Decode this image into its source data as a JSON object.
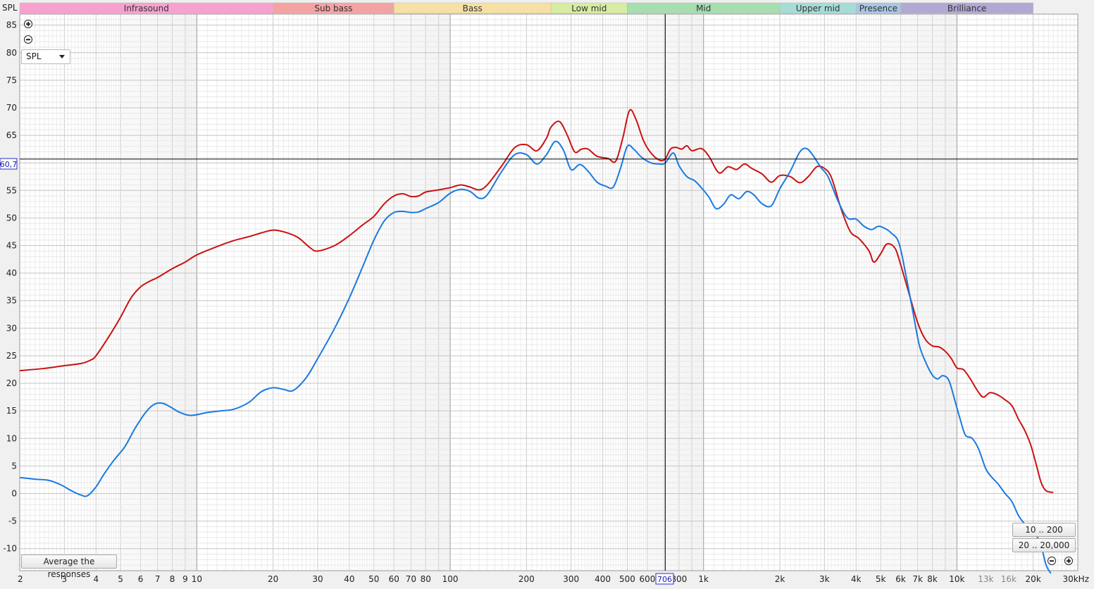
{
  "y_axis_title": "SPL",
  "spl_select": {
    "value": "SPL",
    "icon": "caret-down-icon"
  },
  "cursor": {
    "y_label": "60,7",
    "x_label": "706",
    "x_value": 706,
    "y_value": 60.7
  },
  "buttons": {
    "average": "Average the responses",
    "range_10_200": "10 .. 200",
    "range_20_20000": "20 .. 20,000"
  },
  "icons": {
    "zoom_in": "zoom-in-icon",
    "zoom_out": "zoom-out-icon"
  },
  "colors": {
    "red_trace": "#cc1111",
    "blue_trace": "#1a7ae0",
    "plot_bg": "#ffffff",
    "grid_major": "#9a9a9a",
    "grid_minor": "#dddddd",
    "cursor": "#000000"
  },
  "bands": [
    {
      "label": "Infrasound",
      "from": 2,
      "to": 20,
      "color": "#f7a1cf"
    },
    {
      "label": "Sub bass",
      "from": 20,
      "to": 60,
      "color": "#f4a3a3"
    },
    {
      "label": "Bass",
      "from": 60,
      "to": 250,
      "color": "#f6e0a3"
    },
    {
      "label": "Low mid",
      "from": 250,
      "to": 500,
      "color": "#d8eca2"
    },
    {
      "label": "Mid",
      "from": 500,
      "to": 2000,
      "color": "#a6deb0"
    },
    {
      "label": "Upper mid",
      "from": 2000,
      "to": 4000,
      "color": "#a5dcd6"
    },
    {
      "label": "Presence",
      "from": 4000,
      "to": 6000,
      "color": "#a9c5e5"
    },
    {
      "label": "Brilliance",
      "from": 6000,
      "to": 20000,
      "color": "#b3a7d3"
    }
  ],
  "chart_data": {
    "type": "line",
    "xscale": "log",
    "xlim": [
      2,
      30000
    ],
    "ylim": [
      -14,
      87
    ],
    "xlabel": "",
    "ylabel": "SPL",
    "grid": true,
    "x_tick_labels": [
      {
        "v": 2,
        "t": "2"
      },
      {
        "v": 3,
        "t": "3"
      },
      {
        "v": 4,
        "t": "4"
      },
      {
        "v": 5,
        "t": "5"
      },
      {
        "v": 6,
        "t": "6"
      },
      {
        "v": 7,
        "t": "7"
      },
      {
        "v": 8,
        "t": "8"
      },
      {
        "v": 9,
        "t": "9"
      },
      {
        "v": 10,
        "t": "10"
      },
      {
        "v": 20,
        "t": "20"
      },
      {
        "v": 30,
        "t": "30"
      },
      {
        "v": 40,
        "t": "40"
      },
      {
        "v": 50,
        "t": "50"
      },
      {
        "v": 60,
        "t": "60"
      },
      {
        "v": 70,
        "t": "70"
      },
      {
        "v": 80,
        "t": "80"
      },
      {
        "v": 100,
        "t": "100"
      },
      {
        "v": 200,
        "t": "200"
      },
      {
        "v": 300,
        "t": "300"
      },
      {
        "v": 400,
        "t": "400"
      },
      {
        "v": 500,
        "t": "500"
      },
      {
        "v": 600,
        "t": "600"
      },
      {
        "v": 800,
        "t": "800"
      },
      {
        "v": 1000,
        "t": "1k"
      },
      {
        "v": 2000,
        "t": "2k"
      },
      {
        "v": 3000,
        "t": "3k"
      },
      {
        "v": 4000,
        "t": "4k"
      },
      {
        "v": 5000,
        "t": "5k"
      },
      {
        "v": 6000,
        "t": "6k"
      },
      {
        "v": 7000,
        "t": "7k"
      },
      {
        "v": 8000,
        "t": "8k"
      },
      {
        "v": 10000,
        "t": "10k"
      },
      {
        "v": 13000,
        "t": "13k"
      },
      {
        "v": 16000,
        "t": "16k"
      },
      {
        "v": 20000,
        "t": "20k"
      },
      {
        "v": 30000,
        "t": "30kHz"
      }
    ],
    "y_ticks": [
      -10,
      -5,
      0,
      5,
      10,
      15,
      20,
      25,
      30,
      35,
      40,
      45,
      50,
      55,
      60,
      65,
      70,
      75,
      80,
      85
    ],
    "series": [
      {
        "color": "#cc1111",
        "points": [
          [
            2,
            22.3
          ],
          [
            2.5,
            22.7
          ],
          [
            3,
            23.2
          ],
          [
            3.5,
            23.6
          ],
          [
            3.8,
            24.2
          ],
          [
            4,
            25.0
          ],
          [
            4.5,
            28.5
          ],
          [
            5,
            32.0
          ],
          [
            5.5,
            35.5
          ],
          [
            6,
            37.5
          ],
          [
            6.5,
            38.5
          ],
          [
            7,
            39.2
          ],
          [
            8,
            40.8
          ],
          [
            9,
            42.0
          ],
          [
            10,
            43.3
          ],
          [
            12,
            44.8
          ],
          [
            14,
            45.9
          ],
          [
            16,
            46.6
          ],
          [
            18,
            47.3
          ],
          [
            20,
            47.8
          ],
          [
            22,
            47.5
          ],
          [
            25,
            46.5
          ],
          [
            28,
            44.6
          ],
          [
            30,
            44.0
          ],
          [
            35,
            45.0
          ],
          [
            40,
            46.8
          ],
          [
            45,
            48.7
          ],
          [
            50,
            50.3
          ],
          [
            55,
            52.6
          ],
          [
            60,
            54.0
          ],
          [
            65,
            54.4
          ],
          [
            70,
            53.9
          ],
          [
            75,
            54.0
          ],
          [
            80,
            54.7
          ],
          [
            90,
            55.1
          ],
          [
            100,
            55.5
          ],
          [
            110,
            56.0
          ],
          [
            120,
            55.6
          ],
          [
            130,
            55.1
          ],
          [
            140,
            56.0
          ],
          [
            160,
            59.5
          ],
          [
            180,
            62.8
          ],
          [
            200,
            63.3
          ],
          [
            220,
            62.2
          ],
          [
            240,
            64.5
          ],
          [
            250,
            66.5
          ],
          [
            270,
            67.5
          ],
          [
            290,
            65.0
          ],
          [
            310,
            62.0
          ],
          [
            330,
            62.5
          ],
          [
            350,
            62.5
          ],
          [
            380,
            61.2
          ],
          [
            420,
            60.8
          ],
          [
            450,
            60.3
          ],
          [
            480,
            64.5
          ],
          [
            510,
            69.5
          ],
          [
            540,
            68.0
          ],
          [
            580,
            64.0
          ],
          [
            620,
            61.8
          ],
          [
            670,
            60.5
          ],
          [
            706,
            60.7
          ],
          [
            740,
            62.5
          ],
          [
            780,
            62.8
          ],
          [
            820,
            62.5
          ],
          [
            860,
            63.1
          ],
          [
            900,
            62.2
          ],
          [
            980,
            62.6
          ],
          [
            1050,
            61.2
          ],
          [
            1150,
            58.2
          ],
          [
            1250,
            59.3
          ],
          [
            1350,
            58.8
          ],
          [
            1450,
            59.8
          ],
          [
            1550,
            59.0
          ],
          [
            1700,
            58.0
          ],
          [
            1850,
            56.5
          ],
          [
            2000,
            57.7
          ],
          [
            2200,
            57.5
          ],
          [
            2400,
            56.4
          ],
          [
            2600,
            57.6
          ],
          [
            2800,
            59.3
          ],
          [
            3000,
            59.0
          ],
          [
            3200,
            57.3
          ],
          [
            3500,
            51.5
          ],
          [
            3800,
            47.5
          ],
          [
            4100,
            46.3
          ],
          [
            4500,
            44.0
          ],
          [
            4700,
            42.0
          ],
          [
            5000,
            43.5
          ],
          [
            5300,
            45.3
          ],
          [
            5700,
            44.5
          ],
          [
            6000,
            41.5
          ],
          [
            6500,
            36.0
          ],
          [
            7000,
            31.0
          ],
          [
            7500,
            28.0
          ],
          [
            8000,
            26.8
          ],
          [
            8500,
            26.6
          ],
          [
            9000,
            25.8
          ],
          [
            9500,
            24.5
          ],
          [
            10000,
            22.8
          ],
          [
            10600,
            22.5
          ],
          [
            11300,
            20.8
          ],
          [
            12000,
            18.8
          ],
          [
            12700,
            17.5
          ],
          [
            13500,
            18.3
          ],
          [
            14500,
            17.9
          ],
          [
            15500,
            17.0
          ],
          [
            16500,
            15.9
          ],
          [
            17500,
            13.5
          ],
          [
            18500,
            11.5
          ],
          [
            19500,
            9.0
          ],
          [
            20500,
            5.5
          ],
          [
            21500,
            2.0
          ],
          [
            22500,
            0.5
          ],
          [
            24000,
            0.2
          ]
        ]
      },
      {
        "color": "#1a7ae0",
        "points": [
          [
            2,
            2.9
          ],
          [
            2.3,
            2.6
          ],
          [
            2.6,
            2.4
          ],
          [
            2.9,
            1.6
          ],
          [
            3.2,
            0.5
          ],
          [
            3.5,
            -0.3
          ],
          [
            3.7,
            -0.4
          ],
          [
            4,
            1.2
          ],
          [
            4.3,
            3.5
          ],
          [
            4.7,
            6.0
          ],
          [
            5.2,
            8.5
          ],
          [
            5.7,
            11.8
          ],
          [
            6.3,
            14.8
          ],
          [
            6.8,
            16.2
          ],
          [
            7.3,
            16.4
          ],
          [
            7.8,
            15.8
          ],
          [
            8.5,
            14.8
          ],
          [
            9.3,
            14.2
          ],
          [
            10,
            14.3
          ],
          [
            11,
            14.7
          ],
          [
            12.5,
            15.0
          ],
          [
            14,
            15.3
          ],
          [
            16,
            16.5
          ],
          [
            18,
            18.5
          ],
          [
            20,
            19.2
          ],
          [
            22,
            18.9
          ],
          [
            24,
            18.7
          ],
          [
            27,
            21.0
          ],
          [
            30,
            24.5
          ],
          [
            35,
            30.0
          ],
          [
            40,
            35.5
          ],
          [
            45,
            41.0
          ],
          [
            50,
            46.0
          ],
          [
            55,
            49.5
          ],
          [
            60,
            51.0
          ],
          [
            65,
            51.2
          ],
          [
            70,
            51.0
          ],
          [
            75,
            51.1
          ],
          [
            80,
            51.7
          ],
          [
            90,
            52.8
          ],
          [
            100,
            54.5
          ],
          [
            110,
            55.2
          ],
          [
            120,
            54.8
          ],
          [
            130,
            53.6
          ],
          [
            140,
            54.2
          ],
          [
            160,
            58.5
          ],
          [
            180,
            61.5
          ],
          [
            200,
            61.5
          ],
          [
            220,
            59.8
          ],
          [
            240,
            61.5
          ],
          [
            260,
            63.9
          ],
          [
            280,
            62.3
          ],
          [
            300,
            58.8
          ],
          [
            325,
            59.7
          ],
          [
            350,
            58.5
          ],
          [
            380,
            56.5
          ],
          [
            410,
            55.8
          ],
          [
            440,
            55.6
          ],
          [
            470,
            59.0
          ],
          [
            500,
            63.0
          ],
          [
            530,
            62.5
          ],
          [
            570,
            61.0
          ],
          [
            620,
            60.0
          ],
          [
            670,
            59.8
          ],
          [
            706,
            60.0
          ],
          [
            760,
            61.8
          ],
          [
            800,
            59.5
          ],
          [
            860,
            57.5
          ],
          [
            920,
            56.8
          ],
          [
            980,
            55.5
          ],
          [
            1050,
            53.8
          ],
          [
            1120,
            51.7
          ],
          [
            1200,
            52.5
          ],
          [
            1280,
            54.2
          ],
          [
            1380,
            53.5
          ],
          [
            1480,
            54.8
          ],
          [
            1580,
            54.2
          ],
          [
            1700,
            52.6
          ],
          [
            1850,
            52.2
          ],
          [
            2000,
            55.3
          ],
          [
            2200,
            58.5
          ],
          [
            2400,
            62.0
          ],
          [
            2550,
            62.6
          ],
          [
            2700,
            61.4
          ],
          [
            2900,
            59.2
          ],
          [
            3100,
            57.5
          ],
          [
            3400,
            53.0
          ],
          [
            3700,
            50.0
          ],
          [
            4000,
            49.8
          ],
          [
            4300,
            48.5
          ],
          [
            4600,
            47.9
          ],
          [
            4900,
            48.5
          ],
          [
            5200,
            48.1
          ],
          [
            5500,
            47.3
          ],
          [
            5900,
            45.5
          ],
          [
            6300,
            39.5
          ],
          [
            6700,
            33.0
          ],
          [
            7100,
            27.0
          ],
          [
            7500,
            24.0
          ],
          [
            8000,
            21.5
          ],
          [
            8400,
            20.8
          ],
          [
            8800,
            21.4
          ],
          [
            9300,
            20.5
          ],
          [
            9800,
            17.0
          ],
          [
            10300,
            13.5
          ],
          [
            10800,
            10.6
          ],
          [
            11500,
            10.0
          ],
          [
            12200,
            8.0
          ],
          [
            13000,
            4.5
          ],
          [
            13700,
            3.0
          ],
          [
            14500,
            1.8
          ],
          [
            15500,
            0.0
          ],
          [
            16500,
            -1.5
          ],
          [
            17500,
            -4.0
          ],
          [
            18500,
            -5.5
          ],
          [
            19500,
            -6.5
          ],
          [
            20500,
            -7.5
          ],
          [
            21500,
            -9.5
          ],
          [
            22500,
            -13.0
          ],
          [
            23500,
            -14.5
          ]
        ]
      }
    ]
  }
}
